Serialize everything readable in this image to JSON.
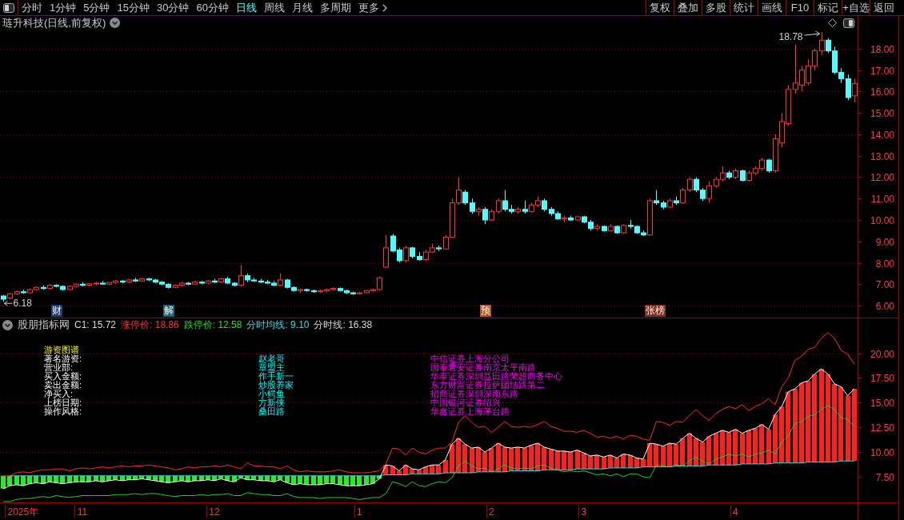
{
  "toolbar": {
    "periods": [
      {
        "label": "分时",
        "kind": "period",
        "selected": false
      },
      {
        "label": "1分钟",
        "kind": "period",
        "selected": false
      },
      {
        "label": "5分钟",
        "kind": "period",
        "selected": false
      },
      {
        "label": "15分钟",
        "kind": "period",
        "selected": false
      },
      {
        "label": "30分钟",
        "kind": "period",
        "selected": false
      },
      {
        "label": "60分钟",
        "kind": "period",
        "selected": false
      },
      {
        "label": "日线",
        "kind": "period",
        "selected": true
      },
      {
        "label": "周线",
        "kind": "period",
        "selected": false
      },
      {
        "label": "月线",
        "kind": "period",
        "selected": false
      },
      {
        "label": "多周期",
        "kind": "period",
        "selected": false
      },
      {
        "label": "更多",
        "kind": "menu",
        "selected": false
      }
    ],
    "actions": [
      "复权",
      "叠加",
      "多股",
      "统计",
      "画线",
      "F10",
      "标记",
      "+自选",
      "返回"
    ]
  },
  "price_pane": {
    "title": "琏升科技(日线,前复权)",
    "event_tags": [
      {
        "label": "财",
        "color": "#1e3f78"
      },
      {
        "label": "解",
        "color": "#1f6470"
      },
      {
        "label": "预",
        "color": "#b8561a"
      },
      {
        "label": "张榜",
        "color": "#8a2f1a"
      }
    ],
    "chart_data": [
      {
        "type": "candlestick",
        "ylim": [
          5.44,
          19.53
        ],
        "tick_labels": "y",
        "grid": true,
        "yticks": [
          {
            "value": 6,
            "label": "6.00"
          },
          {
            "value": 7,
            "label": "7.00"
          },
          {
            "value": 8,
            "label": "8.00"
          },
          {
            "value": 9,
            "label": "9.00"
          },
          {
            "value": 10,
            "label": "10.00"
          },
          {
            "value": 11,
            "label": "11.00"
          },
          {
            "value": 12,
            "label": "12.00"
          },
          {
            "value": 13,
            "label": "13.00"
          },
          {
            "value": 14,
            "label": "14.00"
          },
          {
            "value": 15,
            "label": "15.00"
          },
          {
            "value": 16,
            "label": "16.00"
          },
          {
            "value": 17,
            "label": "17.00"
          },
          {
            "value": 18,
            "label": "18.00"
          }
        ],
        "ohlc": [
          [
            6.45,
            6.5,
            6.18,
            6.3
          ],
          [
            6.35,
            6.6,
            6.3,
            6.55
          ],
          [
            6.55,
            6.7,
            6.5,
            6.65
          ],
          [
            6.65,
            6.75,
            6.55,
            6.6
          ],
          [
            6.6,
            6.8,
            6.58,
            6.75
          ],
          [
            6.75,
            6.9,
            6.7,
            6.85
          ],
          [
            6.85,
            6.95,
            6.75,
            6.8
          ],
          [
            6.8,
            7,
            6.75,
            6.95
          ],
          [
            6.95,
            7,
            6.85,
            6.9
          ],
          [
            6.9,
            6.95,
            6.7,
            6.75
          ],
          [
            6.75,
            6.95,
            6.72,
            6.9
          ],
          [
            6.9,
            7.05,
            6.85,
            7
          ],
          [
            7,
            7.1,
            6.9,
            6.95
          ],
          [
            6.95,
            7.05,
            6.9,
            7.02
          ],
          [
            7.02,
            7.1,
            6.95,
            7.05
          ],
          [
            7.05,
            7.15,
            6.98,
            7
          ],
          [
            7,
            7.1,
            6.95,
            7.08
          ],
          [
            7.08,
            7.2,
            7,
            7.15
          ],
          [
            7.15,
            7.2,
            7.05,
            7.1
          ],
          [
            7.1,
            7.25,
            7.05,
            7.2
          ],
          [
            7.2,
            7.3,
            7.1,
            7.15
          ],
          [
            7.15,
            7.28,
            7.1,
            7.25
          ],
          [
            7.25,
            7.3,
            7.15,
            7.2
          ],
          [
            7.2,
            7.25,
            7.05,
            7.1
          ],
          [
            7.1,
            7.15,
            6.95,
            7
          ],
          [
            7,
            7.05,
            6.8,
            6.85
          ],
          [
            6.85,
            7,
            6.8,
            6.95
          ],
          [
            6.95,
            7.1,
            6.9,
            7.05
          ],
          [
            7.05,
            7.1,
            6.95,
            7
          ],
          [
            7,
            7.15,
            6.98,
            7.1
          ],
          [
            7.1,
            7.15,
            7,
            7.05
          ],
          [
            7.05,
            7.2,
            7,
            7.15
          ],
          [
            7.15,
            7.25,
            7.05,
            7.1
          ],
          [
            7.1,
            7.3,
            7.05,
            7.25
          ],
          [
            7.25,
            7.35,
            7,
            7.05
          ],
          [
            7.05,
            7.1,
            6.9,
            6.95
          ],
          [
            6.95,
            7.9,
            6.9,
            7.4
          ],
          [
            7.4,
            7.5,
            7.1,
            7.2
          ],
          [
            7.2,
            7.3,
            7.1,
            7.15
          ],
          [
            7.15,
            7.25,
            7.05,
            7.1
          ],
          [
            7.1,
            7.2,
            7,
            7.05
          ],
          [
            7.05,
            7.15,
            6.9,
            6.95
          ],
          [
            6.95,
            7.5,
            6.9,
            7.2
          ],
          [
            7.2,
            7.25,
            6.8,
            6.85
          ],
          [
            6.85,
            6.9,
            6.65,
            6.7
          ],
          [
            6.7,
            6.8,
            6.6,
            6.75
          ],
          [
            6.75,
            6.8,
            6.65,
            6.7
          ],
          [
            6.7,
            6.75,
            6.6,
            6.65
          ],
          [
            6.65,
            6.75,
            6.6,
            6.7
          ],
          [
            6.7,
            6.8,
            6.62,
            6.75
          ],
          [
            6.75,
            6.85,
            6.7,
            6.8
          ],
          [
            6.8,
            6.85,
            6.65,
            6.7
          ],
          [
            6.7,
            6.75,
            6.55,
            6.6
          ],
          [
            6.6,
            6.65,
            6.5,
            6.55
          ],
          [
            6.55,
            6.65,
            6.5,
            6.6
          ],
          [
            6.6,
            6.72,
            6.58,
            6.7
          ],
          [
            6.7,
            6.8,
            6.65,
            6.75
          ],
          [
            6.75,
            7.35,
            6.7,
            7.3
          ],
          [
            7.8,
            9.3,
            7.75,
            8.7
          ],
          [
            9.25,
            9.35,
            8.5,
            8.55
          ],
          [
            8.6,
            8.7,
            8,
            8.1
          ],
          [
            8.1,
            8.8,
            8,
            8.7
          ],
          [
            8.7,
            8.75,
            8.2,
            8.3
          ],
          [
            8.3,
            8.5,
            8.1,
            8.15
          ],
          [
            8.15,
            8.6,
            8.1,
            8.5
          ],
          [
            8.5,
            8.9,
            8.45,
            8.7
          ],
          [
            8.7,
            8.8,
            8.55,
            8.65
          ],
          [
            8.65,
            9.3,
            8.6,
            9.2
          ],
          [
            9.2,
            11,
            9.15,
            10.8
          ],
          [
            10.8,
            12,
            10.7,
            11.4
          ],
          [
            11.3,
            11.4,
            10.7,
            10.8
          ],
          [
            10.8,
            11,
            10.3,
            10.4
          ],
          [
            10.4,
            10.6,
            10.2,
            10.5
          ],
          [
            10.5,
            10.6,
            9.8,
            10
          ],
          [
            10,
            10.5,
            9.95,
            10.4
          ],
          [
            10.4,
            11,
            10.3,
            10.9
          ],
          [
            10.9,
            11.4,
            10.4,
            10.5
          ],
          [
            10.5,
            10.7,
            10.3,
            10.4
          ],
          [
            10.4,
            10.6,
            10.3,
            10.5
          ],
          [
            10.5,
            10.9,
            10.3,
            10.4
          ],
          [
            10.4,
            10.8,
            10.35,
            10.7
          ],
          [
            10.7,
            11.1,
            10.6,
            10.9
          ],
          [
            10.9,
            11,
            10.4,
            10.5
          ],
          [
            10.5,
            10.6,
            10.2,
            10.3
          ],
          [
            10.3,
            10.4,
            10,
            10.05
          ],
          [
            10.05,
            10.2,
            9.9,
            10.1
          ],
          [
            10.1,
            10.2,
            9.95,
            10
          ],
          [
            10,
            10.2,
            9.95,
            10.15
          ],
          [
            10.15,
            10.2,
            9.85,
            9.9
          ],
          [
            9.9,
            10,
            9.5,
            9.6
          ],
          [
            9.6,
            9.8,
            9.5,
            9.7
          ],
          [
            9.7,
            9.75,
            9.45,
            9.5
          ],
          [
            9.5,
            9.8,
            9.45,
            9.7
          ],
          [
            9.7,
            9.75,
            9.35,
            9.4
          ],
          [
            9.4,
            9.8,
            9.35,
            9.75
          ],
          [
            9.75,
            10,
            9.6,
            9.7
          ],
          [
            9.7,
            9.75,
            9.35,
            9.4
          ],
          [
            9.4,
            9.5,
            9.25,
            9.3
          ],
          [
            9.3,
            11,
            9.28,
            10.9
          ],
          [
            10.9,
            11.4,
            10.7,
            10.8
          ],
          [
            10.8,
            10.9,
            10.5,
            10.6
          ],
          [
            10.6,
            11,
            10.55,
            10.9
          ],
          [
            10.9,
            11.1,
            10.7,
            10.8
          ],
          [
            10.8,
            11.5,
            10.75,
            11.4
          ],
          [
            11.4,
            12,
            11.3,
            11.9
          ],
          [
            11.9,
            12,
            11.3,
            11.4
          ],
          [
            11.4,
            11.5,
            10.9,
            11
          ],
          [
            11,
            11.8,
            10.8,
            11.6
          ],
          [
            11.6,
            12,
            11.5,
            11.9
          ],
          [
            11.9,
            12.5,
            11.8,
            12.2
          ],
          [
            12.2,
            12.3,
            11.9,
            12
          ],
          [
            12,
            12.4,
            11.9,
            12.3
          ],
          [
            12.3,
            12.35,
            11.8,
            11.85
          ],
          [
            11.85,
            12.3,
            11.8,
            12.2
          ],
          [
            12.2,
            12.5,
            12.1,
            12.4
          ],
          [
            12.4,
            12.9,
            12.3,
            12.8
          ],
          [
            12.8,
            12.85,
            12.2,
            12.3
          ],
          [
            12.3,
            14,
            12.2,
            13.8
          ],
          [
            13.6,
            15,
            13.4,
            14.6
          ],
          [
            14.5,
            16.3,
            14.4,
            16.1
          ],
          [
            16.1,
            18.2,
            15.9,
            16.4
          ],
          [
            16.3,
            17.2,
            16,
            17
          ],
          [
            16.4,
            17.5,
            16.3,
            17.2
          ],
          [
            17.2,
            18,
            17,
            17.9
          ],
          [
            17.9,
            18.78,
            17.7,
            18.4
          ],
          [
            18.4,
            18.5,
            17.8,
            17.9
          ],
          [
            17.9,
            18.1,
            16.8,
            16.9
          ],
          [
            16.9,
            17.1,
            16.4,
            16.6
          ],
          [
            16.6,
            16.8,
            15.6,
            15.72
          ],
          [
            15.8,
            16.6,
            15.5,
            16.38
          ]
        ],
        "annotations": [
          "18.78",
          "6.18"
        ]
      }
    ]
  },
  "indicator_pane": {
    "name": "股朋指标网",
    "readouts": [
      {
        "text": "C1: 15.72",
        "color": "#d8d8d8"
      },
      {
        "text": "涨停价: 18.86",
        "color": "#ff3232"
      },
      {
        "text": "跌停价: 12.58",
        "color": "#22dd22"
      },
      {
        "text": "分时均线: 9.10",
        "color": "#33dddd"
      },
      {
        "text": "分时线: 16.38",
        "color": "#d8d8d8"
      }
    ],
    "hot_money": {
      "title": "游资图谱",
      "labels": [
        "著名游资:",
        "营业部:",
        "买入金额:",
        "卖出金额:",
        "净买入:",
        "上榜日期:",
        "操作风格:"
      ],
      "traders": [
        "赵老哥",
        "章盟主",
        "作手新一",
        "炒股养家",
        "小鳄鱼",
        "方新侠",
        "桑田路"
      ],
      "branches": [
        "中信证券上海分公司",
        "国泰君安证券南京太平南路",
        "华泰证券深圳益田路荣超商务中心",
        "东方财富证券拉萨团结路第二",
        "招商证券深圳深南东路",
        "中国银河证券绍兴",
        "华鑫证券上海茅台路"
      ]
    },
    "chart_data": [
      {
        "type": "bar",
        "ylim": [
          4.91,
          23.52
        ],
        "grid": true,
        "yticks": [
          {
            "value": 7.5,
            "label": "7.50"
          },
          {
            "value": 10,
            "label": "10.00"
          },
          {
            "value": 12.5,
            "label": "12.50"
          },
          {
            "value": 15,
            "label": "15.00"
          },
          {
            "value": 17.5,
            "label": "17.50"
          },
          {
            "value": 20,
            "label": "20.00"
          }
        ],
        "categories": [
          null,
          null,
          null,
          "2025年",
          null,
          null,
          null,
          null,
          null,
          null,
          null,
          null,
          "11",
          null,
          null,
          null,
          null,
          null,
          null,
          null,
          null,
          null,
          null,
          null,
          null,
          null,
          null,
          null,
          null,
          null,
          null,
          null,
          "12",
          null,
          null,
          null,
          null,
          null,
          null,
          null,
          null,
          null,
          null,
          null,
          null,
          null,
          null,
          null,
          null,
          null,
          null,
          null,
          null,
          null,
          "1",
          null,
          null,
          null,
          null,
          null,
          null,
          null,
          null,
          null,
          null,
          null,
          null,
          null,
          null,
          null,
          null,
          null,
          null,
          null,
          "2",
          null,
          null,
          null,
          null,
          null,
          null,
          null,
          null,
          null,
          null,
          null,
          null,
          null,
          "3",
          null,
          null,
          null,
          null,
          null,
          null,
          null,
          null,
          null,
          null,
          null,
          null,
          null,
          null,
          null,
          null,
          null,
          null,
          null,
          null,
          null,
          null,
          "4",
          null,
          null,
          null,
          null,
          null,
          null,
          null,
          null,
          null,
          null,
          null,
          null,
          null,
          null,
          null,
          null,
          null,
          null
        ],
        "series": [
          {
            "type": "bar",
            "colors": [
              "#22ee22",
              "#22ee22",
              "#22ee22",
              "#22ee22",
              "#22ee22",
              "#22ee22",
              "#22ee22",
              "#22ee22",
              "#22ee22",
              "#22ee22",
              "#22ee22",
              "#22ee22",
              "#22ee22",
              "#22ee22",
              "#22ee22",
              "#22ee22",
              "#22ee22",
              "#22ee22",
              "#22ee22",
              "#22ee22",
              "#22ee22",
              "#22ee22",
              "#22ee22",
              "#22ee22",
              "#22ee22",
              "#22ee22",
              "#22ee22",
              "#22ee22",
              "#22ee22",
              "#22ee22",
              "#22ee22",
              "#22ee22",
              "#22ee22",
              "#22ee22",
              "#22ee22",
              "#22ee22",
              "#22ee22",
              "#22ee22",
              "#22ee22",
              "#22ee22",
              "#22ee22",
              "#22ee22",
              "#22ee22",
              "#22ee22",
              "#22ee22",
              "#22ee22",
              "#22ee22",
              "#22ee22",
              "#22ee22",
              "#22ee22",
              "#22ee22",
              "#22ee22",
              "#22ee22",
              "#22ee22",
              "#22ee22",
              "#22ee22",
              "#22ee22",
              "#22ee22",
              "#ff2020",
              "#ff2020",
              "#ff2020",
              "#ff2020",
              "#ff2020",
              "#ff2020",
              "#ff2020",
              "#ff2020",
              "#ff2020",
              "#ff2020",
              "#ff2020",
              "#ff2020",
              "#ff2020",
              "#ff2020",
              "#ff2020",
              "#ff2020",
              "#ff2020",
              "#ff2020",
              "#ff2020",
              "#ff2020",
              "#ff2020",
              "#ff2020",
              "#ff2020",
              "#ff2020",
              "#ff2020",
              "#ff2020",
              "#ff2020",
              "#ff2020",
              "#ff2020",
              "#ff2020",
              "#ff2020",
              "#ff2020",
              "#ff2020",
              "#ff2020",
              "#ff2020",
              "#ff2020",
              "#ff2020",
              "#ff2020",
              "#ff2020",
              "#ff2020",
              "#ff2020",
              "#ff2020",
              "#ff2020",
              "#ff2020",
              "#ff2020",
              "#ff2020",
              "#ff2020",
              "#ff2020",
              "#ff2020",
              "#ff2020",
              "#ff2020",
              "#ff2020",
              "#ff2020",
              "#ff2020",
              "#ff2020",
              "#ff2020",
              "#ff2020",
              "#ff2020",
              "#ff2020",
              "#ff2020",
              "#ff2020",
              "#ff2020",
              "#ff2020",
              "#ff2020",
              "#ff2020",
              "#ff2020",
              "#ff2020",
              "#ff2020",
              "#ff2020",
              "#ff2020",
              "#ff2020",
              "#ff2020"
            ],
            "base": [
              7.6,
              7.6,
              7.6,
              7.6,
              7.6,
              7.6,
              7.6,
              7.6,
              7.6,
              7.6,
              7.6,
              7.6,
              7.6,
              7.6,
              7.6,
              7.6,
              7.6,
              7.6,
              7.6,
              7.6,
              7.6,
              7.6,
              7.6,
              7.6,
              7.6,
              7.6,
              7.6,
              7.6,
              7.6,
              7.6,
              7.6,
              7.6,
              7.6,
              7.6,
              7.6,
              7.6,
              7.6,
              7.6,
              7.6,
              7.6,
              7.6,
              7.6,
              7.6,
              7.6,
              7.6,
              7.6,
              7.6,
              7.6,
              7.6,
              7.6,
              7.6,
              7.6,
              7.6,
              7.6,
              7.6,
              7.6,
              7.6,
              7.6,
              7.7,
              7.7,
              7.7,
              7.7,
              7.8,
              7.8,
              7.8,
              7.8,
              7.8,
              7.9,
              7.9,
              7.9,
              7.9,
              7.9,
              8,
              8,
              8,
              8,
              8,
              8.1,
              8.1,
              8.1,
              8.1,
              8.1,
              8.2,
              8.2,
              8.2,
              8.2,
              8.2,
              8.3,
              8.3,
              8.3,
              8.3,
              8.3,
              8.4,
              8.4,
              8.4,
              8.4,
              8.4,
              8.5,
              8.5,
              8.5,
              8.5,
              8.5,
              8.6,
              8.6,
              8.6,
              8.6,
              8.6,
              8.7,
              8.7,
              8.7,
              8.7,
              8.7,
              8.8,
              8.8,
              8.8,
              8.8,
              8.8,
              8.9,
              8.9,
              8.9,
              8.9,
              8.9,
              9,
              9,
              9,
              9,
              9,
              9.1,
              9.1,
              9.1
            ],
            "values": [
              -1.3,
              -1,
              -0.9,
              -1,
              -0.8,
              -0.7,
              -0.8,
              -0.6,
              -0.7,
              -0.8,
              -0.7,
              -0.6,
              -0.6,
              -0.6,
              -0.5,
              -0.6,
              -0.5,
              -0.4,
              -0.5,
              -0.4,
              -0.4,
              -0.3,
              -0.4,
              -0.5,
              -0.6,
              -0.7,
              -0.6,
              -0.5,
              -0.6,
              -0.5,
              -0.5,
              -0.4,
              -0.5,
              -0.3,
              -0.5,
              -0.6,
              -0.2,
              -0.4,
              -0.4,
              -0.5,
              -0.5,
              -0.6,
              -0.4,
              -0.7,
              -0.9,
              -0.8,
              -0.9,
              -0.9,
              -0.9,
              -0.8,
              -0.8,
              -0.9,
              -1,
              -1,
              -1,
              -0.9,
              -0.8,
              -0.3,
              1,
              0.9,
              0.4,
              1,
              0.5,
              0.4,
              0.7,
              0.9,
              0.9,
              1.3,
              2.9,
              3.5,
              2.9,
              2.5,
              2.5,
              2,
              2.4,
              2.9,
              2.5,
              2.3,
              2.4,
              2.3,
              2.6,
              2.8,
              2.3,
              2.1,
              1.9,
              1.9,
              1.8,
              1.9,
              1.6,
              1.3,
              1.4,
              1.2,
              1.3,
              1,
              1.4,
              1.3,
              1,
              0.8,
              2.4,
              2.3,
              2.1,
              2.4,
              2.2,
              2.8,
              3.3,
              2.8,
              2.4,
              2.9,
              3.2,
              3.5,
              3.3,
              3.6,
              3.1,
              3.4,
              3.6,
              4,
              3.5,
              4.9,
              5.7,
              7.2,
              7.5,
              8.1,
              8.2,
              8.9,
              9.4,
              8.9,
              7.9,
              7.5,
              6.6,
              7.3
            ]
          },
          {
            "type": "line",
            "color": "#ff2a2a",
            "values": [
              7.6,
              7.6,
              7.9,
              8,
              7.9,
              8.1,
              8.2,
              8.2,
              8.3,
              8.3,
              8.1,
              8.3,
              8.4,
              8.3,
              8.4,
              8.5,
              8.4,
              8.5,
              8.6,
              8.5,
              8.6,
              8.6,
              8.7,
              8.6,
              8.5,
              8.4,
              8.2,
              8.3,
              8.5,
              8.4,
              8.5,
              8.5,
              8.6,
              8.5,
              8.7,
              8.5,
              8.3,
              8.9,
              8.6,
              8.6,
              8.5,
              8.5,
              8.3,
              8.6,
              8.2,
              8,
              8.1,
              8,
              8,
              8,
              8.1,
              8.2,
              8,
              7.9,
              7.9,
              7.9,
              8,
              8.1,
              8.8,
              10.4,
              10.3,
              9.7,
              10.4,
              10,
              9.8,
              10.2,
              10.4,
              10.4,
              11,
              13,
              13.7,
              13,
              12.5,
              12.6,
              12,
              12.5,
              13.1,
              12.6,
              12.5,
              12.6,
              12.5,
              12.8,
              13.1,
              12.6,
              12.4,
              12.1,
              12.1,
              12,
              12.2,
              11.9,
              11.5,
              11.6,
              11.4,
              11.6,
              11.3,
              11.7,
              11.6,
              11.3,
              11.2,
              13.1,
              13,
              12.7,
              13.1,
              13,
              13.7,
              14.3,
              13.7,
              13.2,
              13.9,
              14.3,
              14.6,
              14.4,
              14.8,
              14.2,
              14.6,
              14.9,
              15.4,
              14.8,
              16.6,
              17.5,
              19.3,
              19.7,
              20.4,
              20.6,
              21.5,
              22.1,
              21.5,
              20.3,
              19.9,
              18.9
            ]
          },
          {
            "type": "line",
            "color": "#22cc22",
            "values": [
              5,
              5,
              5.2,
              5.3,
              5.3,
              5.4,
              5.5,
              5.4,
              5.6,
              5.5,
              5.4,
              5.5,
              5.6,
              5.6,
              5.6,
              5.6,
              5.6,
              5.7,
              5.7,
              5.7,
              5.8,
              5.7,
              5.8,
              5.8,
              5.7,
              5.6,
              5.5,
              5.6,
              5.6,
              5.6,
              5.7,
              5.6,
              5.7,
              5.7,
              5.8,
              5.6,
              5.6,
              5.9,
              5.8,
              5.7,
              5.7,
              5.6,
              5.6,
              5.8,
              5.5,
              5.4,
              5.4,
              5.4,
              5.3,
              5.4,
              5.4,
              5.4,
              5.4,
              5.3,
              5.2,
              5.3,
              5.4,
              5.4,
              5.8,
              7,
              6.8,
              6.5,
              7,
              6.6,
              6.5,
              6.8,
              7,
              6.9,
              7.4,
              8.6,
              9.1,
              8.6,
              8.3,
              8.4,
              8,
              8.3,
              8.7,
              8.4,
              8.3,
              8.4,
              8.3,
              8.6,
              8.7,
              8.4,
              8.2,
              8,
              8.1,
              8,
              8.1,
              7.9,
              7.7,
              7.8,
              7.6,
              7.8,
              7.5,
              7.8,
              7.8,
              7.5,
              7.4,
              8.7,
              8.6,
              8.5,
              8.7,
              8.6,
              9.1,
              9.5,
              9.1,
              8.8,
              9.3,
              9.5,
              9.8,
              9.6,
              9.8,
              9.5,
              9.8,
              9.9,
              10.2,
              9.8,
              11,
              11.7,
              12.9,
              13.1,
              13.6,
              13.8,
              14.3,
              14.7,
              14.3,
              13.5,
              13.3,
              12.6
            ]
          },
          {
            "type": "line",
            "color": "#33dddd",
            "values": [
              null,
              7.6,
              7.6,
              7.6,
              7.6,
              7.6,
              7.6,
              7.6,
              7.6,
              7.6,
              7.6,
              7.6,
              7.6,
              7.6,
              7.6,
              7.6,
              7.6,
              7.6,
              7.6,
              7.6,
              7.6,
              7.6,
              7.6,
              7.6,
              7.6,
              7.6,
              7.6,
              7.6,
              7.6,
              7.6,
              7.6,
              7.6,
              7.6,
              7.6,
              7.6,
              7.6,
              7.6,
              7.6,
              7.6,
              7.6,
              7.6,
              7.6,
              7.6,
              7.6,
              7.6,
              7.6,
              7.6,
              7.6,
              7.6,
              7.6,
              7.6,
              7.6,
              7.6,
              7.6,
              7.6,
              7.6,
              7.6,
              7.6,
              7.7,
              7.7,
              7.7,
              7.7,
              7.8,
              7.8,
              7.8,
              7.8,
              7.8,
              7.9,
              7.9,
              7.9,
              7.9,
              7.9,
              8,
              8,
              8,
              8,
              8,
              8.1,
              8.1,
              8.1,
              8.1,
              8.1,
              8.2,
              8.2,
              8.2,
              8.2,
              8.2,
              8.3,
              8.3,
              8.3,
              8.3,
              8.3,
              8.4,
              8.4,
              8.4,
              8.4,
              8.4,
              8.5,
              8.5,
              8.5,
              8.5,
              8.5,
              8.6,
              8.6,
              8.6,
              8.6,
              8.6,
              8.7,
              8.7,
              8.7,
              8.7,
              8.7,
              8.8,
              8.8,
              8.8,
              8.8,
              8.8,
              8.9,
              8.9,
              8.9,
              8.9,
              8.9,
              9,
              9,
              9,
              9,
              9,
              9.1,
              9.1,
              9.1
            ]
          },
          {
            "type": "line",
            "color": "#ffffff",
            "values": [
              6.3,
              6.6,
              6.7,
              6.6,
              6.8,
              6.9,
              6.8,
              7,
              6.9,
              6.8,
              6.9,
              7,
              7,
              7,
              7.1,
              7,
              7.1,
              7.2,
              7.1,
              7.2,
              7.2,
              7.3,
              7.2,
              7.1,
              7,
              6.9,
              7,
              7.1,
              7,
              7.1,
              7.1,
              7.2,
              7.1,
              7.3,
              7.1,
              7,
              7.4,
              7.2,
              7.2,
              7.1,
              7.1,
              7,
              7.2,
              6.9,
              6.7,
              6.8,
              6.7,
              6.7,
              6.7,
              6.8,
              6.8,
              6.7,
              6.6,
              6.6,
              6.6,
              6.7,
              6.8,
              7.3,
              8.7,
              8.6,
              8.1,
              8.7,
              8.3,
              8.2,
              8.5,
              8.7,
              8.7,
              9.2,
              10.8,
              11.4,
              10.8,
              10.4,
              10.5,
              10,
              10.4,
              10.9,
              10.5,
              10.4,
              10.5,
              10.4,
              10.7,
              10.9,
              10.5,
              10.3,
              10.1,
              10.1,
              10,
              10.2,
              9.9,
              9.6,
              9.7,
              9.5,
              9.7,
              9.4,
              9.8,
              9.7,
              9.4,
              9.3,
              10.9,
              10.8,
              10.6,
              10.9,
              10.8,
              11.4,
              11.9,
              11.4,
              11,
              11.6,
              11.9,
              12.2,
              12,
              12.3,
              11.9,
              12.2,
              12.4,
              12.8,
              12.3,
              13.8,
              14.6,
              16.1,
              16.4,
              17,
              17.2,
              17.9,
              18.4,
              17.9,
              16.9,
              16.6,
              15.7,
              16.4
            ]
          }
        ]
      }
    ]
  }
}
